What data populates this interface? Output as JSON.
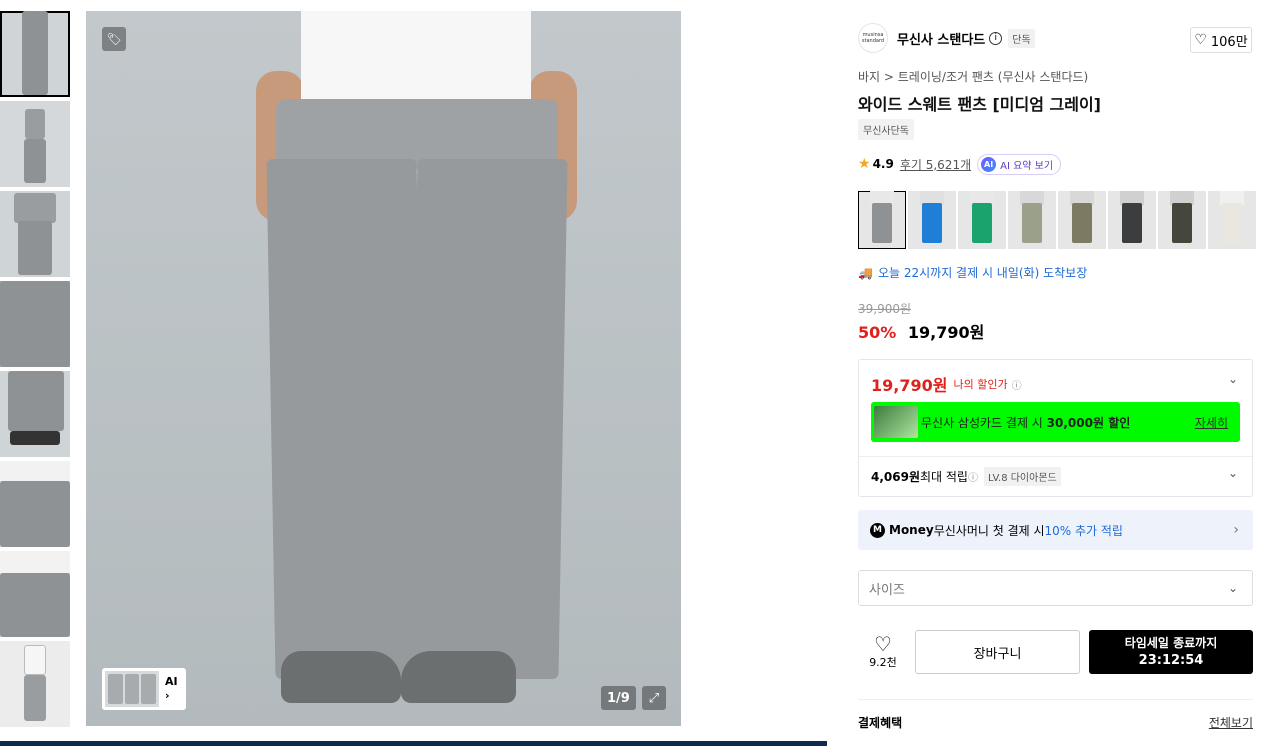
{
  "gallery": {
    "counter": "1/9",
    "ai_label": "AI",
    "ai_arrow": "›",
    "expand_icon": "⤢",
    "tag_icon": "🏷"
  },
  "brand": {
    "logo_text": "musinsa standard",
    "name": "무신사 스탠다드",
    "info_icon": "i",
    "exclusive_badge": "단독",
    "like_count": "106만"
  },
  "breadcrumb": "바지 > 트레이닝/조거 팬츠 (무신사 스탠다드)",
  "product": {
    "title": "와이드 스웨트 팬츠 [미디엄 그레이]",
    "tag": "무신사단독",
    "rating": "4.9",
    "reviews": "후기 5,621개",
    "ai_summary": "AI 요약 보기",
    "ai_dot": "AI"
  },
  "colors": [
    {
      "top": "#e8e8e8",
      "pants": "#8f9294"
    },
    {
      "top": "#e0e0e0",
      "pants": "#1f7fd6"
    },
    {
      "top": "#e8e8e8",
      "pants": "#1aa36a"
    },
    {
      "top": "#d8d8d8",
      "pants": "#9aa08a"
    },
    {
      "top": "#d8d8d8",
      "pants": "#7d7a63"
    },
    {
      "top": "#d0d0d0",
      "pants": "#3b3d3f"
    },
    {
      "top": "#d0d0d0",
      "pants": "#45473d"
    },
    {
      "top": "#f0f0f0",
      "pants": "#e9e7e0"
    }
  ],
  "delivery": {
    "icon": "🚚",
    "text": "오늘 22시까지 결제 시 내일(화) 도착보장"
  },
  "price": {
    "original": "39,900원",
    "discount": "50%",
    "sale": "19,790원"
  },
  "benefit": {
    "my_price": "19,790원",
    "my_price_label": "나의 할인가",
    "info_icon": "ⓘ",
    "card_text_pre": "무신사 삼성카드 결제 시 ",
    "card_text_bold": "30,000원 할인",
    "card_detail": "자세히",
    "points_bold": "4,069원",
    "points_text": " 최대 적립 ",
    "level_badge": "LV.8 다이아몬드",
    "chevron": "⌄"
  },
  "money": {
    "icon": "M",
    "brand": "Money",
    "text_pre": " 무신사머니 첫 결제 시 ",
    "text_blue": "10% 추가 적립",
    "arrow": "›"
  },
  "size_select": {
    "placeholder": "사이즈",
    "chevron": "⌄"
  },
  "actions": {
    "wish_icon": "♡",
    "wish_count": "9.2천",
    "cart_label": "장바구니",
    "timer_label": "타임세일 종료까지",
    "timer_value": "23:12:54"
  },
  "payment": {
    "heading": "결제혜택",
    "view_all": "전체보기"
  }
}
